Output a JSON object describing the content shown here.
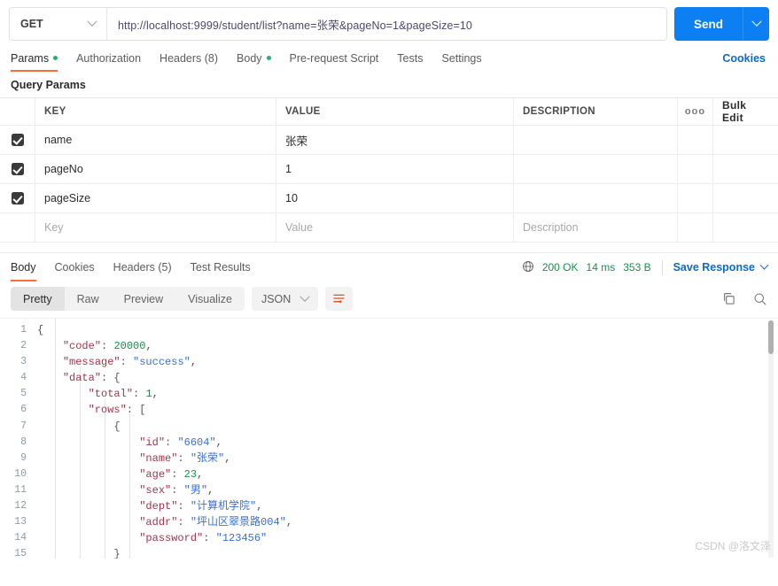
{
  "request": {
    "method": "GET",
    "url": "http://localhost:9999/student/list?name=张荣&pageNo=1&pageSize=10",
    "send_label": "Send",
    "tabs": [
      {
        "label": "Params",
        "dot": true
      },
      {
        "label": "Authorization",
        "dot": false
      },
      {
        "label": "Headers (8)",
        "dot": false
      },
      {
        "label": "Body",
        "dot": true
      },
      {
        "label": "Pre-request Script",
        "dot": false
      },
      {
        "label": "Tests",
        "dot": false
      },
      {
        "label": "Settings",
        "dot": false
      }
    ],
    "cookies_label": "Cookies"
  },
  "params": {
    "section_title": "Query Params",
    "headers": {
      "key": "KEY",
      "value": "VALUE",
      "description": "DESCRIPTION"
    },
    "dots_glyph": "ooo",
    "bulk_edit_label": "Bulk Edit",
    "rows": [
      {
        "checked": true,
        "key": "name",
        "value": "张荣",
        "description": ""
      },
      {
        "checked": true,
        "key": "pageNo",
        "value": "1",
        "description": ""
      },
      {
        "checked": true,
        "key": "pageSize",
        "value": "10",
        "description": ""
      }
    ],
    "placeholder_row": {
      "key": "Key",
      "value": "Value",
      "description": "Description"
    }
  },
  "response": {
    "tabs": [
      "Body",
      "Cookies",
      "Headers (5)",
      "Test Results"
    ],
    "active_tab": "Body",
    "status": "200 OK",
    "time": "14 ms",
    "size": "353 B",
    "save_response_label": "Save Response",
    "view_modes": [
      "Pretty",
      "Raw",
      "Preview",
      "Visualize"
    ],
    "active_view": "Pretty",
    "format": "JSON",
    "colors": {
      "accent": "#ff6c37",
      "link": "#0b6bcb",
      "ok": "#1a8f4a",
      "send": "#0c7ff2"
    },
    "body_lines": [
      {
        "n": 1,
        "indent": 0,
        "tokens": [
          [
            "p",
            "{"
          ]
        ]
      },
      {
        "n": 2,
        "indent": 1,
        "tokens": [
          [
            "k",
            "\"code\""
          ],
          [
            "p",
            ": "
          ],
          [
            "n",
            "20000"
          ],
          [
            "p",
            ","
          ]
        ]
      },
      {
        "n": 3,
        "indent": 1,
        "tokens": [
          [
            "k",
            "\"message\""
          ],
          [
            "p",
            ": "
          ],
          [
            "s",
            "\"success\""
          ],
          [
            "p",
            ","
          ]
        ]
      },
      {
        "n": 4,
        "indent": 1,
        "tokens": [
          [
            "k",
            "\"data\""
          ],
          [
            "p",
            ": {"
          ]
        ]
      },
      {
        "n": 5,
        "indent": 2,
        "tokens": [
          [
            "k",
            "\"total\""
          ],
          [
            "p",
            ": "
          ],
          [
            "n",
            "1"
          ],
          [
            "p",
            ","
          ]
        ]
      },
      {
        "n": 6,
        "indent": 2,
        "tokens": [
          [
            "k",
            "\"rows\""
          ],
          [
            "p",
            ": ["
          ]
        ]
      },
      {
        "n": 7,
        "indent": 3,
        "tokens": [
          [
            "p",
            "{"
          ]
        ]
      },
      {
        "n": 8,
        "indent": 4,
        "tokens": [
          [
            "k",
            "\"id\""
          ],
          [
            "p",
            ": "
          ],
          [
            "s",
            "\"6604\""
          ],
          [
            "p",
            ","
          ]
        ]
      },
      {
        "n": 9,
        "indent": 4,
        "tokens": [
          [
            "k",
            "\"name\""
          ],
          [
            "p",
            ": "
          ],
          [
            "s",
            "\"张荣\""
          ],
          [
            "p",
            ","
          ]
        ]
      },
      {
        "n": 10,
        "indent": 4,
        "tokens": [
          [
            "k",
            "\"age\""
          ],
          [
            "p",
            ": "
          ],
          [
            "n",
            "23"
          ],
          [
            "p",
            ","
          ]
        ]
      },
      {
        "n": 11,
        "indent": 4,
        "tokens": [
          [
            "k",
            "\"sex\""
          ],
          [
            "p",
            ": "
          ],
          [
            "s",
            "\"男\""
          ],
          [
            "p",
            ","
          ]
        ]
      },
      {
        "n": 12,
        "indent": 4,
        "tokens": [
          [
            "k",
            "\"dept\""
          ],
          [
            "p",
            ": "
          ],
          [
            "s",
            "\"计算机学院\""
          ],
          [
            "p",
            ","
          ]
        ]
      },
      {
        "n": 13,
        "indent": 4,
        "tokens": [
          [
            "k",
            "\"addr\""
          ],
          [
            "p",
            ": "
          ],
          [
            "s",
            "\"坪山区翠景路004\""
          ],
          [
            "p",
            ","
          ]
        ]
      },
      {
        "n": 14,
        "indent": 4,
        "tokens": [
          [
            "k",
            "\"password\""
          ],
          [
            "p",
            ": "
          ],
          [
            "s",
            "\"123456\""
          ]
        ]
      },
      {
        "n": 15,
        "indent": 3,
        "tokens": [
          [
            "p",
            "}"
          ]
        ]
      }
    ]
  },
  "watermark": "CSDN @洛文泽"
}
